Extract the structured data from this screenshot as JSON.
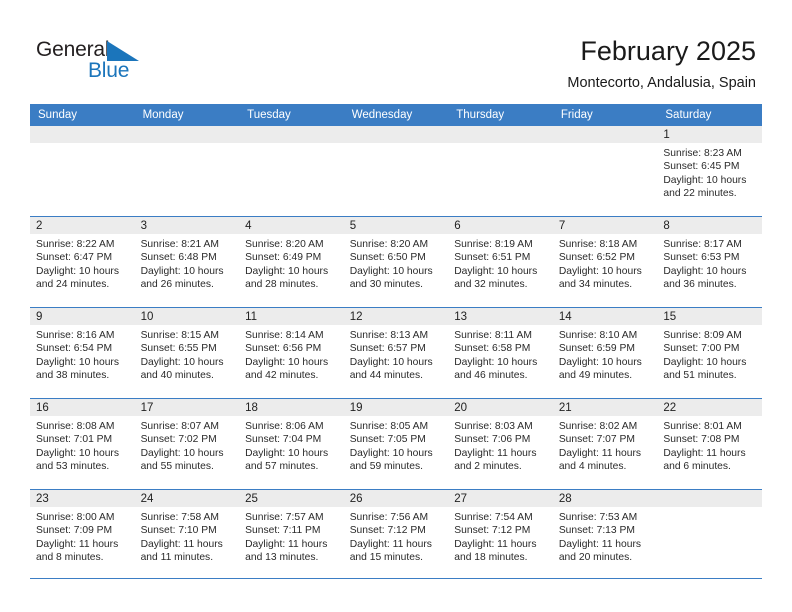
{
  "brand": {
    "name_part1": "General",
    "name_part2": "Blue",
    "accent_color": "#1b75bb"
  },
  "header": {
    "title": "February 2025",
    "location": "Montecorto, Andalusia, Spain"
  },
  "theme": {
    "header_row_color": "#3b7dc4",
    "daynum_band_color": "#ececec",
    "text_color": "#2a2a2a"
  },
  "weekday_headers": [
    "Sunday",
    "Monday",
    "Tuesday",
    "Wednesday",
    "Thursday",
    "Friday",
    "Saturday"
  ],
  "weeks": [
    [
      {
        "day": "",
        "empty": true
      },
      {
        "day": "",
        "empty": true
      },
      {
        "day": "",
        "empty": true
      },
      {
        "day": "",
        "empty": true
      },
      {
        "day": "",
        "empty": true
      },
      {
        "day": "",
        "empty": true
      },
      {
        "day": "1",
        "sunrise": "Sunrise: 8:23 AM",
        "sunset": "Sunset: 6:45 PM",
        "daylight_line1": "Daylight: 10 hours",
        "daylight_line2": "and 22 minutes."
      }
    ],
    [
      {
        "day": "2",
        "sunrise": "Sunrise: 8:22 AM",
        "sunset": "Sunset: 6:47 PM",
        "daylight_line1": "Daylight: 10 hours",
        "daylight_line2": "and 24 minutes."
      },
      {
        "day": "3",
        "sunrise": "Sunrise: 8:21 AM",
        "sunset": "Sunset: 6:48 PM",
        "daylight_line1": "Daylight: 10 hours",
        "daylight_line2": "and 26 minutes."
      },
      {
        "day": "4",
        "sunrise": "Sunrise: 8:20 AM",
        "sunset": "Sunset: 6:49 PM",
        "daylight_line1": "Daylight: 10 hours",
        "daylight_line2": "and 28 minutes."
      },
      {
        "day": "5",
        "sunrise": "Sunrise: 8:20 AM",
        "sunset": "Sunset: 6:50 PM",
        "daylight_line1": "Daylight: 10 hours",
        "daylight_line2": "and 30 minutes."
      },
      {
        "day": "6",
        "sunrise": "Sunrise: 8:19 AM",
        "sunset": "Sunset: 6:51 PM",
        "daylight_line1": "Daylight: 10 hours",
        "daylight_line2": "and 32 minutes."
      },
      {
        "day": "7",
        "sunrise": "Sunrise: 8:18 AM",
        "sunset": "Sunset: 6:52 PM",
        "daylight_line1": "Daylight: 10 hours",
        "daylight_line2": "and 34 minutes."
      },
      {
        "day": "8",
        "sunrise": "Sunrise: 8:17 AM",
        "sunset": "Sunset: 6:53 PM",
        "daylight_line1": "Daylight: 10 hours",
        "daylight_line2": "and 36 minutes."
      }
    ],
    [
      {
        "day": "9",
        "sunrise": "Sunrise: 8:16 AM",
        "sunset": "Sunset: 6:54 PM",
        "daylight_line1": "Daylight: 10 hours",
        "daylight_line2": "and 38 minutes."
      },
      {
        "day": "10",
        "sunrise": "Sunrise: 8:15 AM",
        "sunset": "Sunset: 6:55 PM",
        "daylight_line1": "Daylight: 10 hours",
        "daylight_line2": "and 40 minutes."
      },
      {
        "day": "11",
        "sunrise": "Sunrise: 8:14 AM",
        "sunset": "Sunset: 6:56 PM",
        "daylight_line1": "Daylight: 10 hours",
        "daylight_line2": "and 42 minutes."
      },
      {
        "day": "12",
        "sunrise": "Sunrise: 8:13 AM",
        "sunset": "Sunset: 6:57 PM",
        "daylight_line1": "Daylight: 10 hours",
        "daylight_line2": "and 44 minutes."
      },
      {
        "day": "13",
        "sunrise": "Sunrise: 8:11 AM",
        "sunset": "Sunset: 6:58 PM",
        "daylight_line1": "Daylight: 10 hours",
        "daylight_line2": "and 46 minutes."
      },
      {
        "day": "14",
        "sunrise": "Sunrise: 8:10 AM",
        "sunset": "Sunset: 6:59 PM",
        "daylight_line1": "Daylight: 10 hours",
        "daylight_line2": "and 49 minutes."
      },
      {
        "day": "15",
        "sunrise": "Sunrise: 8:09 AM",
        "sunset": "Sunset: 7:00 PM",
        "daylight_line1": "Daylight: 10 hours",
        "daylight_line2": "and 51 minutes."
      }
    ],
    [
      {
        "day": "16",
        "sunrise": "Sunrise: 8:08 AM",
        "sunset": "Sunset: 7:01 PM",
        "daylight_line1": "Daylight: 10 hours",
        "daylight_line2": "and 53 minutes."
      },
      {
        "day": "17",
        "sunrise": "Sunrise: 8:07 AM",
        "sunset": "Sunset: 7:02 PM",
        "daylight_line1": "Daylight: 10 hours",
        "daylight_line2": "and 55 minutes."
      },
      {
        "day": "18",
        "sunrise": "Sunrise: 8:06 AM",
        "sunset": "Sunset: 7:04 PM",
        "daylight_line1": "Daylight: 10 hours",
        "daylight_line2": "and 57 minutes."
      },
      {
        "day": "19",
        "sunrise": "Sunrise: 8:05 AM",
        "sunset": "Sunset: 7:05 PM",
        "daylight_line1": "Daylight: 10 hours",
        "daylight_line2": "and 59 minutes."
      },
      {
        "day": "20",
        "sunrise": "Sunrise: 8:03 AM",
        "sunset": "Sunset: 7:06 PM",
        "daylight_line1": "Daylight: 11 hours",
        "daylight_line2": "and 2 minutes."
      },
      {
        "day": "21",
        "sunrise": "Sunrise: 8:02 AM",
        "sunset": "Sunset: 7:07 PM",
        "daylight_line1": "Daylight: 11 hours",
        "daylight_line2": "and 4 minutes."
      },
      {
        "day": "22",
        "sunrise": "Sunrise: 8:01 AM",
        "sunset": "Sunset: 7:08 PM",
        "daylight_line1": "Daylight: 11 hours",
        "daylight_line2": "and 6 minutes."
      }
    ],
    [
      {
        "day": "23",
        "sunrise": "Sunrise: 8:00 AM",
        "sunset": "Sunset: 7:09 PM",
        "daylight_line1": "Daylight: 11 hours",
        "daylight_line2": "and 8 minutes."
      },
      {
        "day": "24",
        "sunrise": "Sunrise: 7:58 AM",
        "sunset": "Sunset: 7:10 PM",
        "daylight_line1": "Daylight: 11 hours",
        "daylight_line2": "and 11 minutes."
      },
      {
        "day": "25",
        "sunrise": "Sunrise: 7:57 AM",
        "sunset": "Sunset: 7:11 PM",
        "daylight_line1": "Daylight: 11 hours",
        "daylight_line2": "and 13 minutes."
      },
      {
        "day": "26",
        "sunrise": "Sunrise: 7:56 AM",
        "sunset": "Sunset: 7:12 PM",
        "daylight_line1": "Daylight: 11 hours",
        "daylight_line2": "and 15 minutes."
      },
      {
        "day": "27",
        "sunrise": "Sunrise: 7:54 AM",
        "sunset": "Sunset: 7:12 PM",
        "daylight_line1": "Daylight: 11 hours",
        "daylight_line2": "and 18 minutes."
      },
      {
        "day": "28",
        "sunrise": "Sunrise: 7:53 AM",
        "sunset": "Sunset: 7:13 PM",
        "daylight_line1": "Daylight: 11 hours",
        "daylight_line2": "and 20 minutes."
      },
      {
        "day": "",
        "empty": true
      }
    ]
  ]
}
